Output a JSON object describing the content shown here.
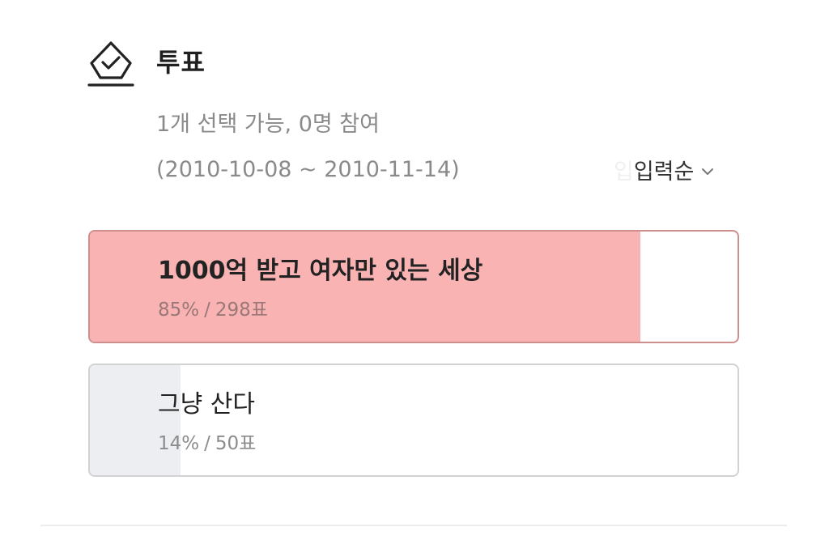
{
  "vote": {
    "title": "투표",
    "icon": "ballot-check-icon",
    "meta": "1개 선택 가능, 0명 참여",
    "period": "(2010-10-08 ~ 2010-11-14)",
    "sort": {
      "ghost": "입",
      "label": "입력순",
      "icon": "chevron-down-icon"
    },
    "options": [
      {
        "label": "1000억 받고 여자만 있는 세상",
        "percent": "85%",
        "votes": "298표",
        "separator": "/",
        "fill_fraction": 0.85,
        "fill_color": "#f9b3b3",
        "selected": true
      },
      {
        "label": "그냥 산다",
        "percent": "14%",
        "votes": "50표",
        "separator": "/",
        "fill_fraction": 0.14,
        "fill_color": "#eceef1",
        "selected": false
      }
    ]
  },
  "colors": {
    "selected_border": "#ce8e8e",
    "default_border": "#d2d2d2",
    "meta_text": "#8a8a8a"
  }
}
